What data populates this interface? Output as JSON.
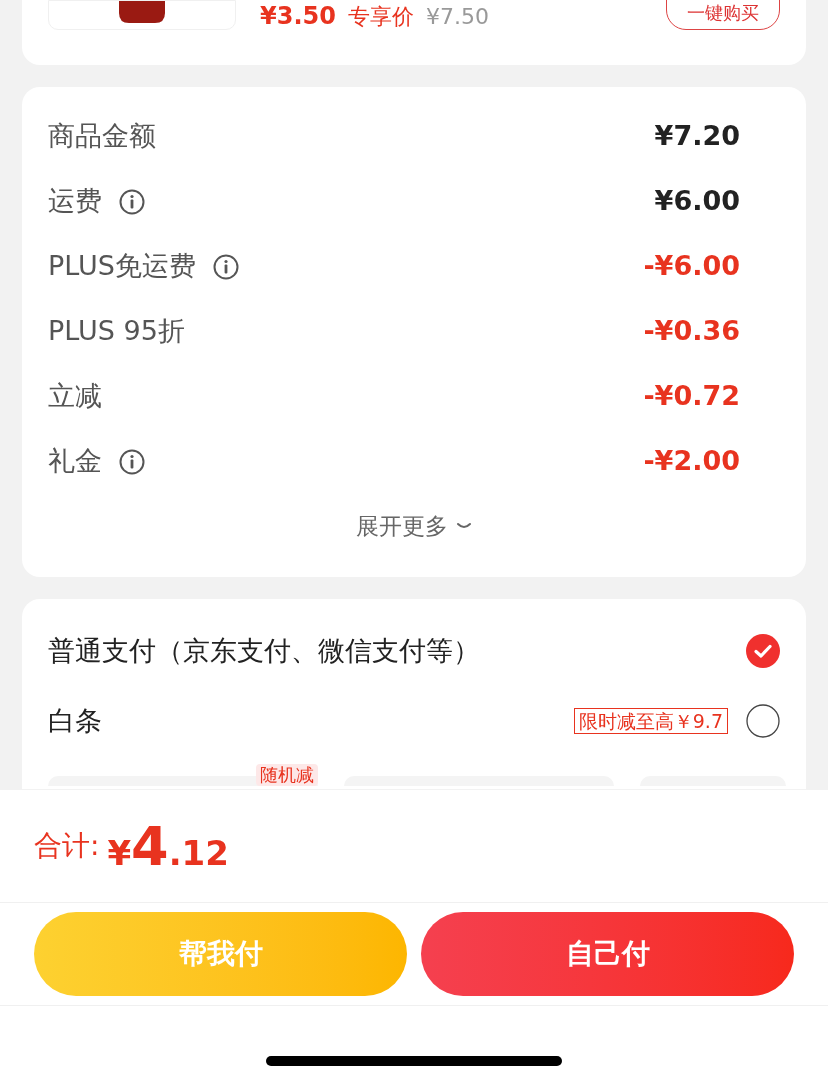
{
  "product": {
    "price": "¥3.50",
    "price_label": "专享价",
    "original_price": "¥7.50",
    "button": "一键购买"
  },
  "summary": {
    "rows": [
      {
        "label": "商品金额",
        "info": false,
        "discount": false,
        "amount": "¥7.20"
      },
      {
        "label": "运费",
        "info": true,
        "discount": false,
        "amount": "¥6.00"
      },
      {
        "label": "PLUS免运费",
        "info": true,
        "discount": true,
        "amount": "-¥6.00"
      },
      {
        "label": "PLUS 95折",
        "info": false,
        "discount": true,
        "amount": "-¥0.36"
      },
      {
        "label": "立减",
        "info": false,
        "discount": true,
        "amount": "-¥0.72"
      },
      {
        "label": "礼金",
        "info": true,
        "discount": true,
        "amount": "-¥2.00"
      }
    ],
    "expand": "展开更多"
  },
  "payment": {
    "options": [
      {
        "label": "普通支付（京东支付、微信支付等）",
        "selected": true
      },
      {
        "label": "白条",
        "selected": false,
        "badge": "限时减至高￥9.7"
      }
    ],
    "tile_badges": [
      "随机减"
    ]
  },
  "total": {
    "label": "合计:",
    "currency": "¥",
    "integer": "4",
    "decimal": ".12"
  },
  "buttons": [
    {
      "label": "帮我付",
      "kind": "secondary"
    },
    {
      "label": "自己付",
      "kind": "primary"
    }
  ]
}
